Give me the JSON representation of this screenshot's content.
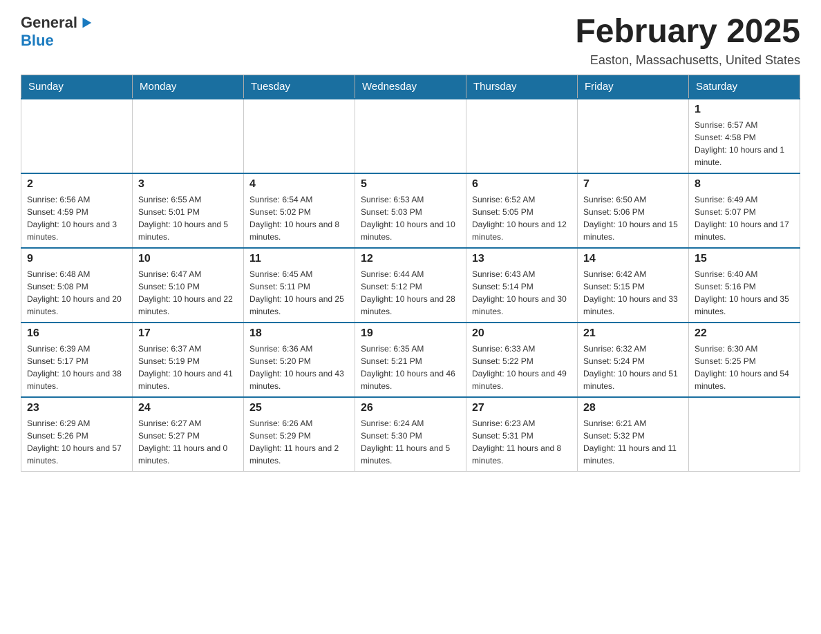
{
  "header": {
    "logo_general": "General",
    "logo_blue": "Blue",
    "month_title": "February 2025",
    "location": "Easton, Massachusetts, United States"
  },
  "days_of_week": [
    "Sunday",
    "Monday",
    "Tuesday",
    "Wednesday",
    "Thursday",
    "Friday",
    "Saturday"
  ],
  "weeks": [
    [
      {
        "day": "",
        "info": ""
      },
      {
        "day": "",
        "info": ""
      },
      {
        "day": "",
        "info": ""
      },
      {
        "day": "",
        "info": ""
      },
      {
        "day": "",
        "info": ""
      },
      {
        "day": "",
        "info": ""
      },
      {
        "day": "1",
        "info": "Sunrise: 6:57 AM\nSunset: 4:58 PM\nDaylight: 10 hours and 1 minute."
      }
    ],
    [
      {
        "day": "2",
        "info": "Sunrise: 6:56 AM\nSunset: 4:59 PM\nDaylight: 10 hours and 3 minutes."
      },
      {
        "day": "3",
        "info": "Sunrise: 6:55 AM\nSunset: 5:01 PM\nDaylight: 10 hours and 5 minutes."
      },
      {
        "day": "4",
        "info": "Sunrise: 6:54 AM\nSunset: 5:02 PM\nDaylight: 10 hours and 8 minutes."
      },
      {
        "day": "5",
        "info": "Sunrise: 6:53 AM\nSunset: 5:03 PM\nDaylight: 10 hours and 10 minutes."
      },
      {
        "day": "6",
        "info": "Sunrise: 6:52 AM\nSunset: 5:05 PM\nDaylight: 10 hours and 12 minutes."
      },
      {
        "day": "7",
        "info": "Sunrise: 6:50 AM\nSunset: 5:06 PM\nDaylight: 10 hours and 15 minutes."
      },
      {
        "day": "8",
        "info": "Sunrise: 6:49 AM\nSunset: 5:07 PM\nDaylight: 10 hours and 17 minutes."
      }
    ],
    [
      {
        "day": "9",
        "info": "Sunrise: 6:48 AM\nSunset: 5:08 PM\nDaylight: 10 hours and 20 minutes."
      },
      {
        "day": "10",
        "info": "Sunrise: 6:47 AM\nSunset: 5:10 PM\nDaylight: 10 hours and 22 minutes."
      },
      {
        "day": "11",
        "info": "Sunrise: 6:45 AM\nSunset: 5:11 PM\nDaylight: 10 hours and 25 minutes."
      },
      {
        "day": "12",
        "info": "Sunrise: 6:44 AM\nSunset: 5:12 PM\nDaylight: 10 hours and 28 minutes."
      },
      {
        "day": "13",
        "info": "Sunrise: 6:43 AM\nSunset: 5:14 PM\nDaylight: 10 hours and 30 minutes."
      },
      {
        "day": "14",
        "info": "Sunrise: 6:42 AM\nSunset: 5:15 PM\nDaylight: 10 hours and 33 minutes."
      },
      {
        "day": "15",
        "info": "Sunrise: 6:40 AM\nSunset: 5:16 PM\nDaylight: 10 hours and 35 minutes."
      }
    ],
    [
      {
        "day": "16",
        "info": "Sunrise: 6:39 AM\nSunset: 5:17 PM\nDaylight: 10 hours and 38 minutes."
      },
      {
        "day": "17",
        "info": "Sunrise: 6:37 AM\nSunset: 5:19 PM\nDaylight: 10 hours and 41 minutes."
      },
      {
        "day": "18",
        "info": "Sunrise: 6:36 AM\nSunset: 5:20 PM\nDaylight: 10 hours and 43 minutes."
      },
      {
        "day": "19",
        "info": "Sunrise: 6:35 AM\nSunset: 5:21 PM\nDaylight: 10 hours and 46 minutes."
      },
      {
        "day": "20",
        "info": "Sunrise: 6:33 AM\nSunset: 5:22 PM\nDaylight: 10 hours and 49 minutes."
      },
      {
        "day": "21",
        "info": "Sunrise: 6:32 AM\nSunset: 5:24 PM\nDaylight: 10 hours and 51 minutes."
      },
      {
        "day": "22",
        "info": "Sunrise: 6:30 AM\nSunset: 5:25 PM\nDaylight: 10 hours and 54 minutes."
      }
    ],
    [
      {
        "day": "23",
        "info": "Sunrise: 6:29 AM\nSunset: 5:26 PM\nDaylight: 10 hours and 57 minutes."
      },
      {
        "day": "24",
        "info": "Sunrise: 6:27 AM\nSunset: 5:27 PM\nDaylight: 11 hours and 0 minutes."
      },
      {
        "day": "25",
        "info": "Sunrise: 6:26 AM\nSunset: 5:29 PM\nDaylight: 11 hours and 2 minutes."
      },
      {
        "day": "26",
        "info": "Sunrise: 6:24 AM\nSunset: 5:30 PM\nDaylight: 11 hours and 5 minutes."
      },
      {
        "day": "27",
        "info": "Sunrise: 6:23 AM\nSunset: 5:31 PM\nDaylight: 11 hours and 8 minutes."
      },
      {
        "day": "28",
        "info": "Sunrise: 6:21 AM\nSunset: 5:32 PM\nDaylight: 11 hours and 11 minutes."
      },
      {
        "day": "",
        "info": ""
      }
    ]
  ]
}
